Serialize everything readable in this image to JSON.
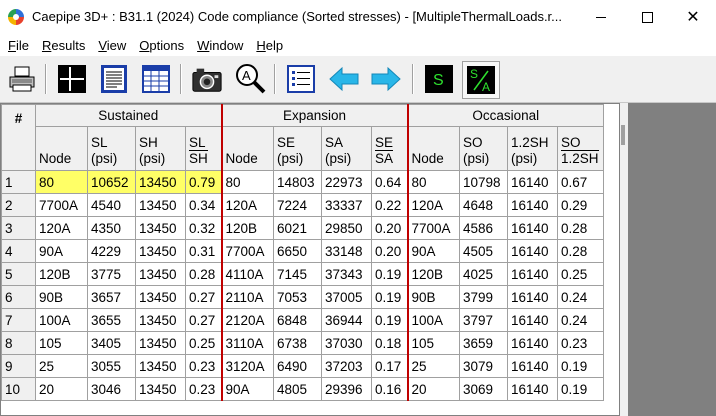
{
  "window": {
    "title": "Caepipe 3D+ : B31.1 (2024) Code compliance (Sorted stresses) -  [MultipleThermalLoads.r..."
  },
  "menu": [
    {
      "key": "F",
      "rest": "ile"
    },
    {
      "key": "R",
      "rest": "esults"
    },
    {
      "key": "V",
      "rest": "iew"
    },
    {
      "key": "O",
      "rest": "ptions"
    },
    {
      "key": "W",
      "rest": "indow"
    },
    {
      "key": "H",
      "rest": "elp"
    }
  ],
  "toolbar": {
    "icons": [
      "printer-icon",
      "grid-lines-icon",
      "text-report-icon",
      "table-view-icon",
      "camera-icon",
      "zoom-a-icon",
      "list-icon",
      "arrow-left-icon",
      "arrow-right-icon",
      "s-icon",
      "s-over-a-icon"
    ],
    "s_label": "S",
    "sa_top": "S",
    "sa_bottom": "A",
    "zoom_letter": "A"
  },
  "table": {
    "corner": "#",
    "groups": [
      "Sustained",
      "Expansion",
      "Occasional"
    ],
    "columns": {
      "sustained": {
        "node": "Node",
        "sl": [
          "SL",
          "(psi)"
        ],
        "sh": [
          "SH",
          "(psi)"
        ],
        "ratio_num": "SL",
        "ratio_den": "SH"
      },
      "expansion": {
        "node": "Node",
        "se": [
          "SE",
          "(psi)"
        ],
        "sa": [
          "SA",
          "(psi)"
        ],
        "ratio_num": "SE",
        "ratio_den": "SA"
      },
      "occasional": {
        "node": "Node",
        "so": [
          "SO",
          "(psi)"
        ],
        "sh12": [
          "1.2SH",
          "(psi)"
        ],
        "ratio_num": "SO",
        "ratio_den": "1.2SH"
      }
    },
    "rows": [
      [
        "1",
        "80",
        "10652",
        "13450",
        "0.79",
        "80",
        "14803",
        "22973",
        "0.64",
        "80",
        "10798",
        "16140",
        "0.67"
      ],
      [
        "2",
        "7700A",
        "4540",
        "13450",
        "0.34",
        "120A",
        "7224",
        "33337",
        "0.22",
        "120A",
        "4648",
        "16140",
        "0.29"
      ],
      [
        "3",
        "120A",
        "4350",
        "13450",
        "0.32",
        "120B",
        "6021",
        "29850",
        "0.20",
        "7700A",
        "4586",
        "16140",
        "0.28"
      ],
      [
        "4",
        "90A",
        "4229",
        "13450",
        "0.31",
        "7700A",
        "6650",
        "33148",
        "0.20",
        "90A",
        "4505",
        "16140",
        "0.28"
      ],
      [
        "5",
        "120B",
        "3775",
        "13450",
        "0.28",
        "4110A",
        "7145",
        "37343",
        "0.19",
        "120B",
        "4025",
        "16140",
        "0.25"
      ],
      [
        "6",
        "90B",
        "3657",
        "13450",
        "0.27",
        "2110A",
        "7053",
        "37005",
        "0.19",
        "90B",
        "3799",
        "16140",
        "0.24"
      ],
      [
        "7",
        "100A",
        "3655",
        "13450",
        "0.27",
        "2120A",
        "6848",
        "36944",
        "0.19",
        "100A",
        "3797",
        "16140",
        "0.24"
      ],
      [
        "8",
        "105",
        "3405",
        "13450",
        "0.25",
        "3110A",
        "6738",
        "37030",
        "0.18",
        "105",
        "3659",
        "16140",
        "0.23"
      ],
      [
        "9",
        "25",
        "3055",
        "13450",
        "0.23",
        "3120A",
        "6490",
        "37203",
        "0.17",
        "25",
        "3079",
        "16140",
        "0.19"
      ],
      [
        "10",
        "20",
        "3046",
        "13450",
        "0.23",
        "90A",
        "4805",
        "29396",
        "0.16",
        "20",
        "3069",
        "16140",
        "0.19"
      ]
    ]
  },
  "colors": {
    "highlight": "#ffff66",
    "separator": "#c00000",
    "arrow": "#29b6e8"
  }
}
